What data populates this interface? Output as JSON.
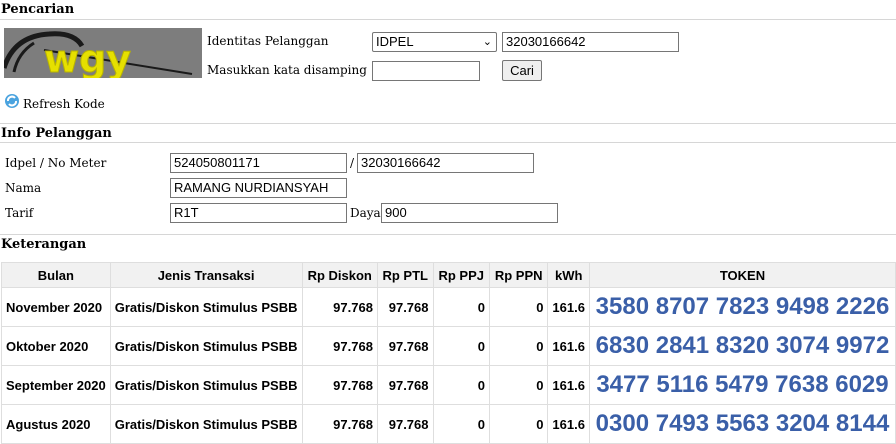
{
  "search": {
    "header": "Pencarian",
    "captcha_text": "wgy",
    "customer_id_label": "Identitas Pelanggan",
    "id_type_selected": "IDPEL",
    "customer_id_value": "32030166642",
    "captcha_label": "Masukkan kata disamping",
    "captcha_input_value": "",
    "search_button": "Cari",
    "refresh_label": "Refresh Kode"
  },
  "info": {
    "header": "Info Pelanggan",
    "idpel_label": "Idpel / No Meter",
    "meter_no": "524050801171",
    "separator": "/",
    "idpel": "32030166642",
    "name_label": "Nama",
    "name_value": "RAMANG NURDIANSYAH",
    "tariff_label": "Tarif",
    "tariff_value": "R1T",
    "power_label": "Daya",
    "power_value": "900"
  },
  "notes": {
    "header": "Keterangan",
    "columns": [
      "Bulan",
      "Jenis Transaksi",
      "Rp Diskon",
      "Rp PTL",
      "Rp PPJ",
      "Rp PPN",
      "kWh",
      "TOKEN"
    ],
    "rows": [
      [
        "November 2020",
        "Gratis/Diskon Stimulus PSBB",
        "97.768",
        "97.768",
        "0",
        "0",
        "161.6",
        "3580 8707 7823 9498 2226"
      ],
      [
        "Oktober 2020",
        "Gratis/Diskon Stimulus PSBB",
        "97.768",
        "97.768",
        "0",
        "0",
        "161.6",
        "6830 2841 8320 3074 9972"
      ],
      [
        "September 2020",
        "Gratis/Diskon Stimulus PSBB",
        "97.768",
        "97.768",
        "0",
        "0",
        "161.6",
        "3477 5116 5479 7638 6029"
      ],
      [
        "Agustus 2020",
        "Gratis/Diskon Stimulus PSBB",
        "97.768",
        "97.768",
        "0",
        "0",
        "161.6",
        "0300 7493 5563 3204 8144"
      ]
    ]
  },
  "colors": {
    "token": "#3a5fa8",
    "header_bg": "#f1f1f1"
  }
}
